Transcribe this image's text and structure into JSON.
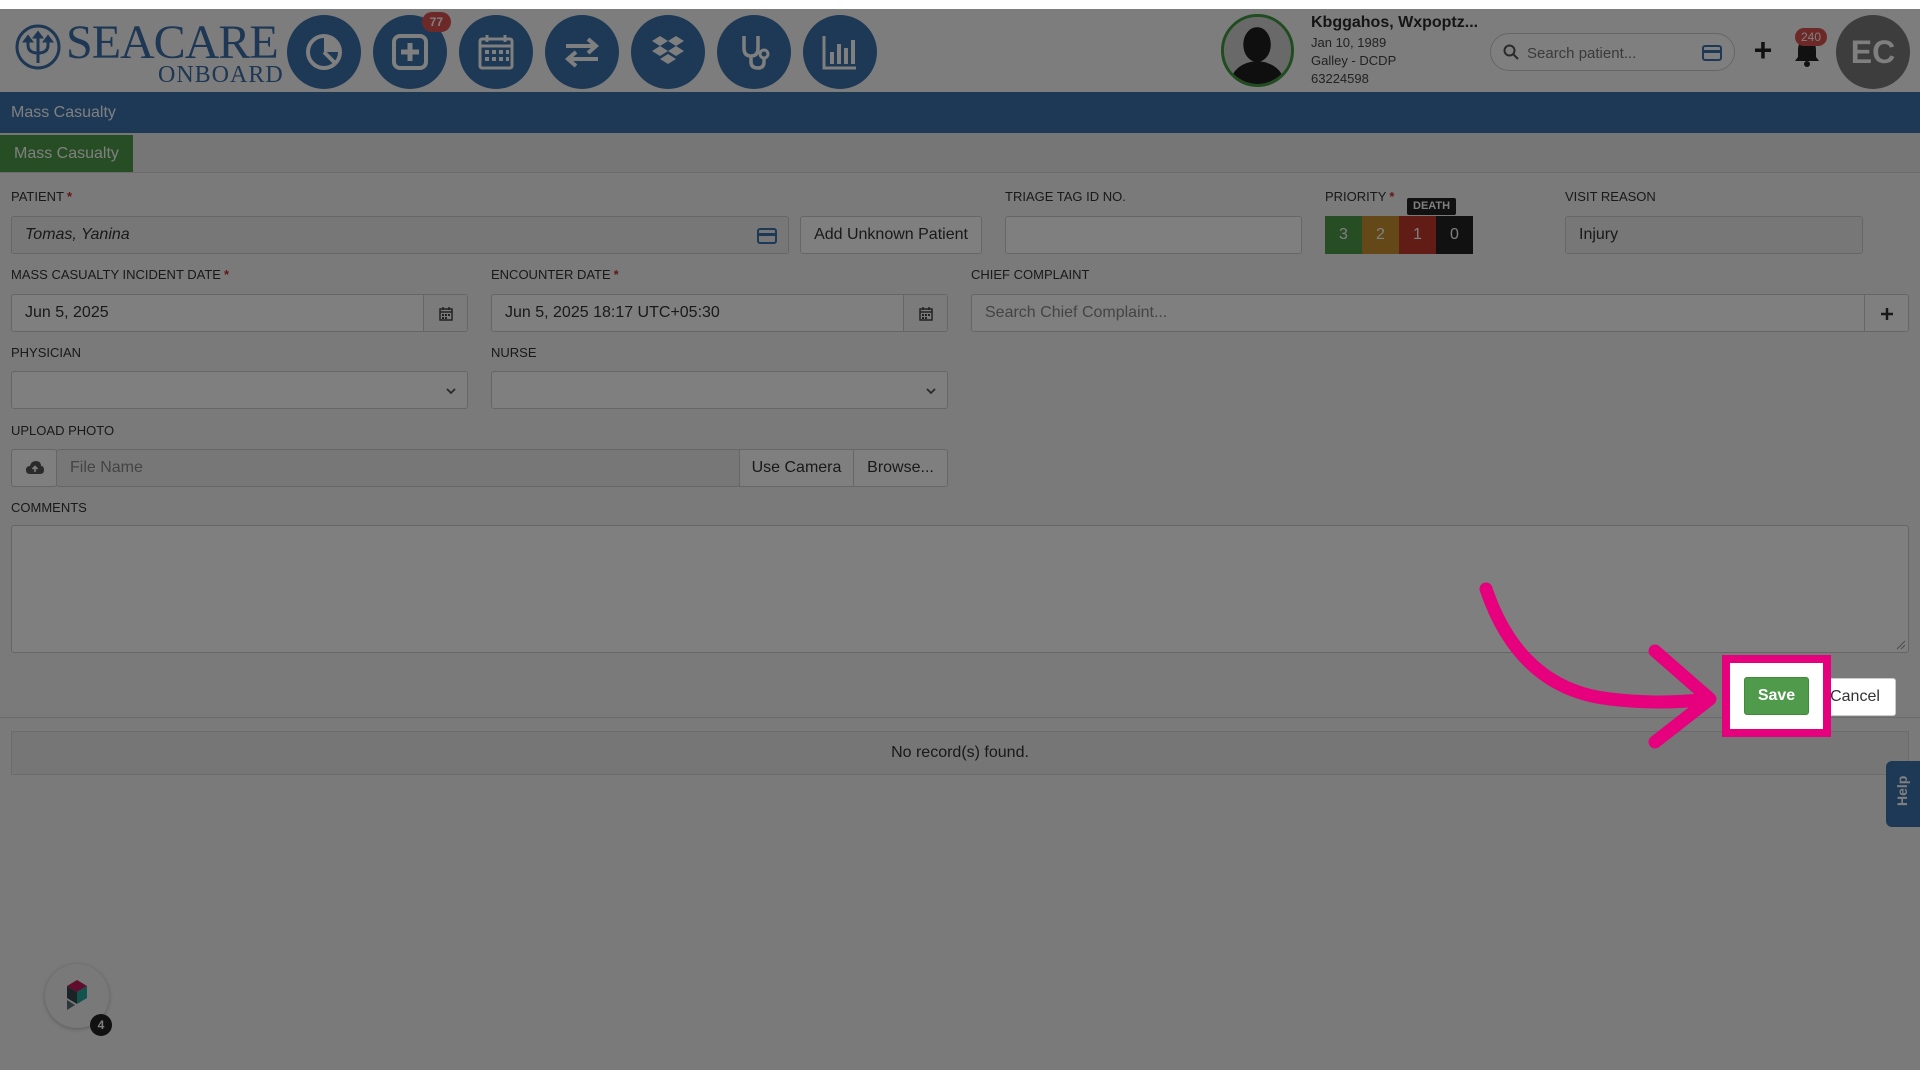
{
  "header": {
    "logo": {
      "brand": "SEACARE",
      "sub": "ONBOARD"
    },
    "nav": [
      {
        "name": "dashboard",
        "icon": "pie-chart-icon",
        "badge": ""
      },
      {
        "name": "medical",
        "icon": "medical-cross-icon",
        "badge": "77"
      },
      {
        "name": "calendar",
        "icon": "calendar-icon",
        "badge": ""
      },
      {
        "name": "transfer",
        "icon": "exchange-arrows-icon",
        "badge": ""
      },
      {
        "name": "dropbox",
        "icon": "dropbox-icon",
        "badge": ""
      },
      {
        "name": "stethoscope",
        "icon": "stethoscope-icon",
        "badge": ""
      },
      {
        "name": "reports",
        "icon": "bar-chart-icon",
        "badge": ""
      }
    ],
    "patient": {
      "name": "Kbggahos, Wxpoptz...",
      "dob": "Jan 10, 1989",
      "location": "Galley - DCDP",
      "id": "63224598"
    },
    "search": {
      "placeholder": "Search patient..."
    },
    "notifications": "240",
    "user_initials": "EC"
  },
  "page": {
    "title": "Mass Casualty",
    "tab": "Mass Casualty"
  },
  "form": {
    "patient": {
      "label": "PATIENT",
      "value": "Tomas, Yanina"
    },
    "add_unknown_label": "Add Unknown Patient",
    "triage": {
      "label": "TRIAGE TAG ID NO.",
      "value": ""
    },
    "priority": {
      "label": "PRIORITY",
      "death_tag": "DEATH",
      "levels": [
        {
          "value": "3",
          "color": "#4f9a4b"
        },
        {
          "value": "2",
          "color": "#c8912f"
        },
        {
          "value": "1",
          "color": "#c0392b"
        },
        {
          "value": "0",
          "color": "#222222"
        }
      ]
    },
    "visit_reason": {
      "label": "VISIT REASON",
      "value": "Injury"
    },
    "incident_date": {
      "label": "MASS CASUALTY INCIDENT DATE",
      "value": "Jun 5, 2025"
    },
    "encounter_date": {
      "label": "ENCOUNTER DATE",
      "value": "Jun 5, 2025 18:17 UTC+05:30"
    },
    "chief_complaint": {
      "label": "CHIEF COMPLAINT",
      "placeholder": "Search Chief Complaint..."
    },
    "physician": {
      "label": "PHYSICIAN",
      "value": ""
    },
    "nurse": {
      "label": "NURSE",
      "value": ""
    },
    "upload": {
      "label": "UPLOAD PHOTO",
      "placeholder": "File Name",
      "camera_label": "Use Camera",
      "browse_label": "Browse..."
    },
    "comments": {
      "label": "COMMENTS"
    },
    "save_label": "Save",
    "cancel_label": "Cancel"
  },
  "results": {
    "empty_text": "No record(s) found."
  },
  "help_label": "Help",
  "widget_badge": "4",
  "colors": {
    "primary": "#3b72ad",
    "success": "#4f9a4b",
    "highlight": "#e6007e",
    "danger": "#d9534f"
  }
}
